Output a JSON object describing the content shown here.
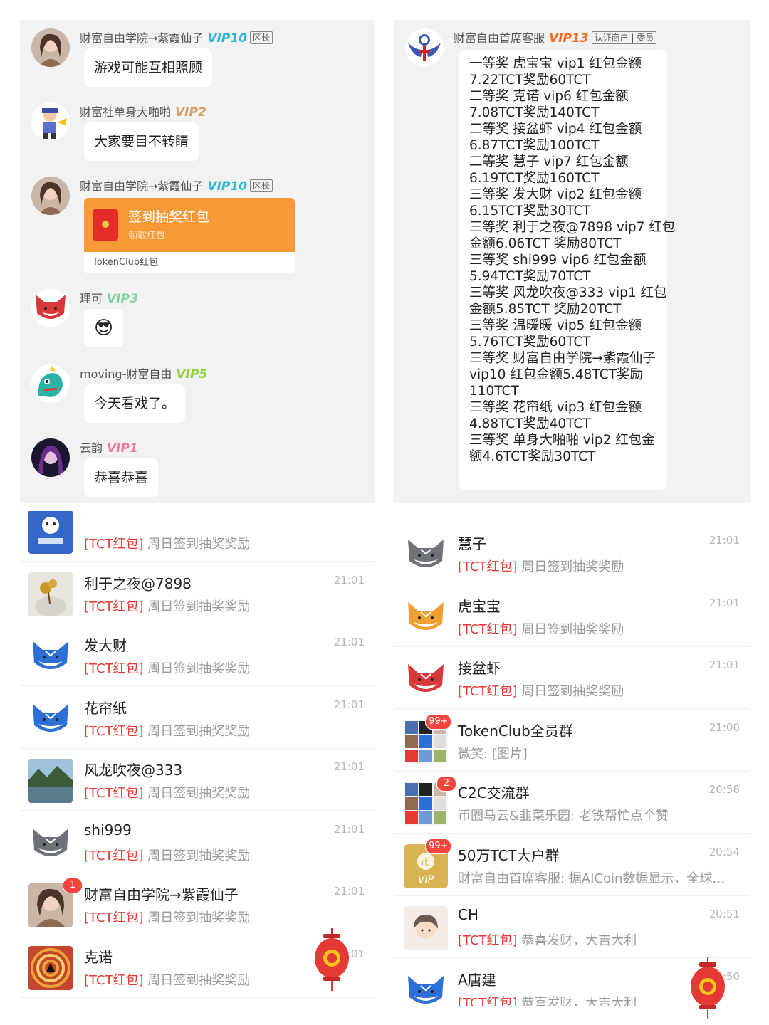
{
  "chat": {
    "messages": [
      {
        "sender": "财富自由学院→紫霞仙子",
        "vip": "VIP10",
        "vip_color": "#29b6d8",
        "tag": "区长",
        "text": "游戏可能互相照顾"
      },
      {
        "sender": "财富社单身大啪啪",
        "vip": "VIP2",
        "vip_color": "#d9a062",
        "tag": "",
        "text": "大家要目不转睛"
      },
      {
        "sender": "财富自由学院→紫霞仙子",
        "vip": "VIP10",
        "vip_color": "#29b6d8",
        "tag": "区长",
        "redpacket": {
          "title": "签到抽奖红包",
          "subtitle": "领取红包",
          "footer": "TokenClub红包"
        }
      },
      {
        "sender": "理可",
        "vip": "VIP3",
        "vip_color": "#7ed3a3",
        "tag": "",
        "emoji": "😎"
      },
      {
        "sender": "moving-财富自由",
        "vip": "VIP5",
        "vip_color": "#8fd13a",
        "tag": "",
        "text": "今天看戏了。"
      },
      {
        "sender": "云韵",
        "vip": "VIP1",
        "vip_color": "#f07e9a",
        "tag": "",
        "text": "恭喜恭喜"
      }
    ]
  },
  "announcement": {
    "sender": "财富自由首席客服",
    "vip": "VIP13",
    "vip_color": "#ff6a1a",
    "tag": "认证商户 | 委员",
    "lines": [
      "一等奖 虎宝宝  vip1  红包金额",
      "7.22TCT奖励60TCT",
      "二等奖 克诺  vip6  红包金额",
      "7.08TCT奖励140TCT",
      "二等奖 接盆虾  vip4  红包金额",
      "6.87TCT奖励100TCT",
      "二等奖 慧子  vip7  红包金额",
      "6.19TCT奖励160TCT",
      "三等奖 发大财  vip2  红包金额",
      "6.15TCT奖励30TCT",
      "三等奖 利于之夜@7898 vip7  红包",
      "金额6.06TCT 奖励80TCT",
      "三等奖 shi999  vip6  红包金额",
      "5.94TCT奖励70TCT",
      "三等奖 风龙吹夜@333 vip1  红包",
      "金额5.85TCT 奖励20TCT",
      "三等奖 温暖暖  vip5  红包金额",
      "5.76TCT奖励60TCT",
      "三等奖 财富自由学院→紫霞仙子",
      "vip10  红包金额5.48TCT奖励",
      "110TCT",
      "三等奖 花帘纸  vip3  红包金额",
      "4.88TCT奖励40TCT",
      "三等奖 单身大啪啪  vip2  红包金",
      "额4.6TCT奖励30TCT"
    ]
  },
  "list_left": [
    {
      "name": "",
      "time": "",
      "prefix": "[TCT红包]",
      "preview": "周日签到抽奖奖励",
      "avatar": "tokenclub-logo",
      "badge": ""
    },
    {
      "name": "利于之夜@7898",
      "time": "21:01",
      "prefix": "[TCT红包]",
      "preview": "周日签到抽奖奖励",
      "avatar": "flower-photo",
      "badge": ""
    },
    {
      "name": "发大财",
      "time": "21:01",
      "prefix": "[TCT红包]",
      "preview": "周日签到抽奖奖励",
      "avatar": "blue-fox",
      "badge": ""
    },
    {
      "name": "花帘纸",
      "time": "21:01",
      "prefix": "[TCT红包]",
      "preview": "周日签到抽奖奖励",
      "avatar": "blue-fox",
      "badge": ""
    },
    {
      "name": "风龙吹夜@333",
      "time": "21:01",
      "prefix": "[TCT红包]",
      "preview": "周日签到抽奖奖励",
      "avatar": "landscape-photo",
      "badge": ""
    },
    {
      "name": "shi999",
      "time": "21:01",
      "prefix": "[TCT红包]",
      "preview": "周日签到抽奖奖励",
      "avatar": "grey-fox",
      "badge": ""
    },
    {
      "name": "财富自由学院→紫霞仙子",
      "time": "21:01",
      "prefix": "[TCT红包]",
      "preview": "周日签到抽奖奖励",
      "avatar": "girl-photo",
      "badge": "1"
    },
    {
      "name": "克诺",
      "time": "21:01",
      "prefix": "[TCT红包]",
      "preview": "周日签到抽奖奖励",
      "avatar": "spiral-art",
      "badge": ""
    }
  ],
  "list_right": [
    {
      "name": "慧子",
      "time": "21:01",
      "prefix": "[TCT红包]",
      "preview": "周日签到抽奖奖励",
      "avatar": "grey-fox",
      "badge": ""
    },
    {
      "name": "虎宝宝",
      "time": "21:01",
      "prefix": "[TCT红包]",
      "preview": "周日签到抽奖奖励",
      "avatar": "orange-fox",
      "badge": ""
    },
    {
      "name": "接盆虾",
      "time": "21:01",
      "prefix": "[TCT红包]",
      "preview": "周日签到抽奖奖励",
      "avatar": "red-fox",
      "badge": ""
    },
    {
      "name": "TokenClub全员群",
      "time": "21:00",
      "prefix": "",
      "preview": "微笑: [图片]",
      "avatar": "group-grid",
      "badge": "99+"
    },
    {
      "name": "C2C交流群",
      "time": "20:58",
      "prefix": "",
      "preview": "币圈马云&韭菜乐园: 老铁帮忙点个赞",
      "avatar": "group-grid",
      "badge": "2"
    },
    {
      "name": "50万TCT大户群",
      "time": "20:54",
      "prefix": "",
      "preview": "财富自由首席客服: 据AICoin数据显示，全球…",
      "avatar": "vip-gold",
      "badge": "99+"
    },
    {
      "name": "CH",
      "time": "20:51",
      "prefix": "[TCT红包]",
      "preview": "恭喜发财，大吉大利",
      "avatar": "cartoon-boy",
      "badge": ""
    },
    {
      "name": "A唐建",
      "time": "20:50",
      "prefix": "[TCT红包]",
      "preview": "恭喜发财，大吉大利",
      "avatar": "blue-fox",
      "badge": ""
    }
  ],
  "colors": {
    "tct_red": "#e53935",
    "redpacket_orange": "#f79a36",
    "badge_red": "#f2453d"
  }
}
